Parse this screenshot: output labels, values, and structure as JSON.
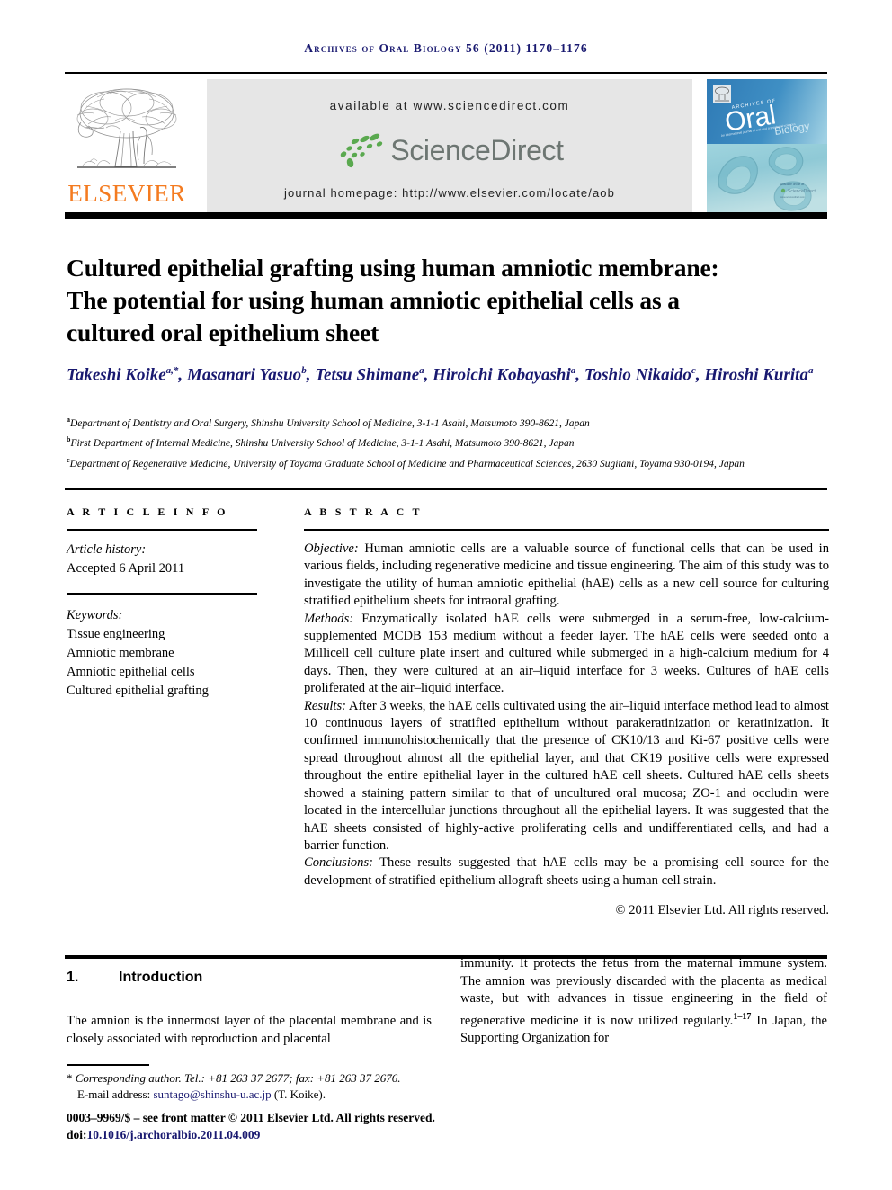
{
  "running_head": "Archives of Oral Biology 56 (2011) 1170–1176",
  "header": {
    "publisher_name": "ELSEVIER",
    "publisher_logo": "elsevier-tree-logo",
    "available_at": "available at www.sciencedirect.com",
    "sciencedirect_wordmark": "ScienceDirect",
    "journal_homepage": "journal homepage: http://www.elsevier.com/locate/aob",
    "cover": {
      "journal_line1": "ARCHIVES OF",
      "journal_line2": "Oral",
      "journal_line3": "Biology",
      "tagline": "An international journal of oral and craniofacial sciences",
      "badge": "Available online at ScienceDirect"
    },
    "colors": {
      "elsevier_orange": "#F47B20",
      "band_gray": "#e6e6e6",
      "sciencedirect_green": "#4fa24a",
      "sciencedirect_gray": "#6d7672",
      "cover_blue": "#2a6ca8",
      "accent_navy": "#191970"
    }
  },
  "title": "Cultured epithelial grafting using human amniotic membrane: The potential for using human amniotic epithelial cells as a cultured oral epithelium sheet",
  "authors_html": "Takeshi Koike<sup>a,*</sup>, Masanari Yasuo<sup>b</sup>, Tetsu Shimane<sup>a</sup>, Hiroichi Kobayashi<sup>a</sup>, Toshio Nikaido<sup>c</sup>, Hiroshi Kurita<sup>a</sup>",
  "affiliations": [
    {
      "marker": "a",
      "text": "Department of Dentistry and Oral Surgery, Shinshu University School of Medicine, 3-1-1 Asahi, Matsumoto 390-8621, Japan"
    },
    {
      "marker": "b",
      "text": "First Department of Internal Medicine, Shinshu University School of Medicine, 3-1-1 Asahi, Matsumoto 390-8621, Japan"
    },
    {
      "marker": "c",
      "text": "Department of Regenerative Medicine, University of Toyama Graduate School of Medicine and Pharmaceutical Sciences, 2630 Sugitani, Toyama 930-0194, Japan"
    }
  ],
  "article_info": {
    "label": "A R T I C L E   I N F O",
    "history_label": "Article history:",
    "history_value": "Accepted 6 April 2011",
    "keywords_label": "Keywords:",
    "keywords": [
      "Tissue engineering",
      "Amniotic membrane",
      "Amniotic epithelial cells",
      "Cultured epithelial grafting"
    ]
  },
  "abstract": {
    "label": "A B S T R A C T",
    "sections": [
      {
        "heading": "Objective:",
        "text": " Human amniotic cells are a valuable source of functional cells that can be used in various fields, including regenerative medicine and tissue engineering. The aim of this study was to investigate the utility of human amniotic epithelial (hAE) cells as a new cell source for culturing stratified epithelium sheets for intraoral grafting."
      },
      {
        "heading": "Methods:",
        "text": " Enzymatically isolated hAE cells were submerged in a serum-free, low-calcium-supplemented MCDB 153 medium without a feeder layer. The hAE cells were seeded onto a Millicell cell culture plate insert and cultured while submerged in a high-calcium medium for 4 days. Then, they were cultured at an air–liquid interface for 3 weeks. Cultures of hAE cells proliferated at the air–liquid interface."
      },
      {
        "heading": "Results:",
        "text": " After 3 weeks, the hAE cells cultivated using the air–liquid interface method lead to almost 10 continuous layers of stratified epithelium without parakeratinization or keratinization. It confirmed immunohistochemically that the presence of CK10/13 and Ki-67 positive cells were spread throughout almost all the epithelial layer, and that CK19 positive cells were expressed throughout the entire epithelial layer in the cultured hAE cell sheets. Cultured hAE cells sheets showed a staining pattern similar to that of uncultured oral mucosa; ZO-1 and occludin were located in the intercellular junctions throughout all the epithelial layers. It was suggested that the hAE sheets consisted of highly-active proliferating cells and undifferentiated cells, and had a barrier function."
      },
      {
        "heading": "Conclusions:",
        "text": " These results suggested that hAE cells may be a promising cell source for the development of stratified epithelium allograft sheets using a human cell strain."
      }
    ],
    "copyright": "© 2011 Elsevier Ltd. All rights reserved."
  },
  "body": {
    "section_number": "1.",
    "section_title": "Introduction",
    "left_column": "The amnion is the innermost layer of the placental membrane and is closely associated with reproduction and placental",
    "right_column_pre": "immunity. It protects the fetus from the maternal immune system. The amnion was previously discarded with the placenta as medical waste, but with advances in tissue engineering in the field of regenerative medicine it is now utilized regularly.",
    "right_column_ref": "1–17",
    "right_column_post": " In Japan, the Supporting Organization for"
  },
  "footnotes": {
    "corresponding_marker": "*",
    "corresponding": "Corresponding author. Tel.: +81 263 37 2677; fax: +81 263 37 2676.",
    "email_label": "E-mail address:",
    "email": "suntago@shinshu-u.ac.jp",
    "email_owner": "(T. Koike).",
    "front_matter": "0003–9969/$ – see front matter © 2011 Elsevier Ltd. All rights reserved.",
    "doi_label": "doi:",
    "doi": "10.1016/j.archoralbio.2011.04.009"
  }
}
